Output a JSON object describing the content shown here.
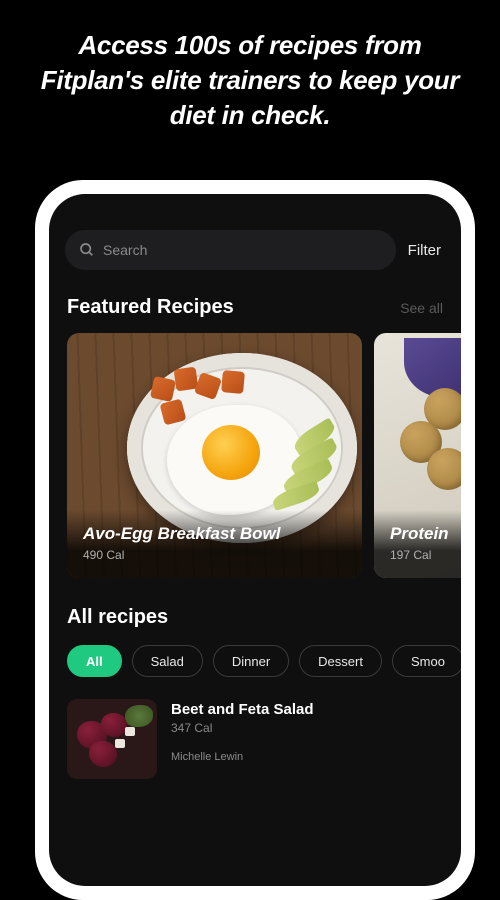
{
  "headline": "Access 100s of recipes from Fitplan's elite trainers to keep your diet in check.",
  "search": {
    "placeholder": "Search",
    "filter_label": "Filter"
  },
  "featured": {
    "title": "Featured Recipes",
    "see_all": "See all",
    "cards": [
      {
        "title": "Avo-Egg Breakfast Bowl",
        "calories": "490 Cal"
      },
      {
        "title": "Protein",
        "calories": "197 Cal"
      }
    ]
  },
  "all_recipes": {
    "title": "All recipes",
    "chips": [
      "All",
      "Salad",
      "Dinner",
      "Dessert",
      "Smoo"
    ],
    "items": [
      {
        "title": "Beet and Feta Salad",
        "calories": "347 Cal",
        "author": "Michelle Lewin"
      }
    ]
  }
}
